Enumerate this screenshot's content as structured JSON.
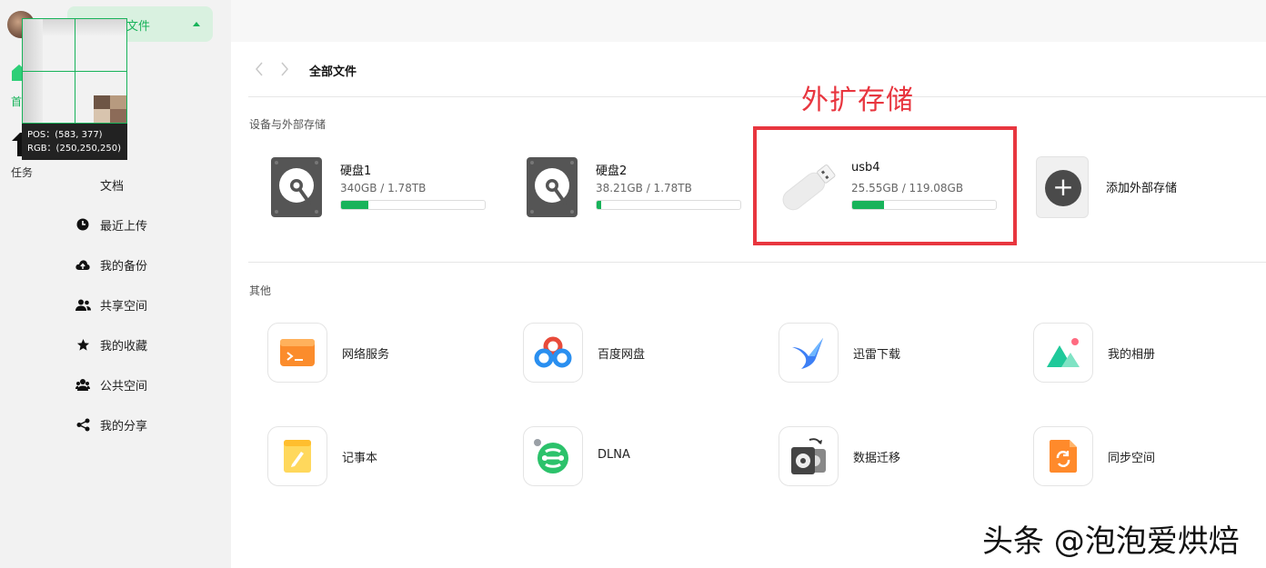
{
  "rail": {
    "home_label": "首",
    "task_label": "任务"
  },
  "sidebar": {
    "all_files_label": "文件",
    "items": [
      {
        "label": "文档",
        "icon": "document-icon"
      },
      {
        "label": "最近上传",
        "icon": "clock-icon"
      },
      {
        "label": "我的备份",
        "icon": "cloud-upload-icon"
      },
      {
        "label": "共享空间",
        "icon": "users-icon"
      },
      {
        "label": "我的收藏",
        "icon": "star-icon"
      },
      {
        "label": "公共空间",
        "icon": "group-icon"
      },
      {
        "label": "我的分享",
        "icon": "share-icon"
      }
    ]
  },
  "magnifier": {
    "pos": "POS：(583, 377)",
    "rgb": "RGB：(250,250,250)"
  },
  "main": {
    "breadcrumb": "全部文件",
    "devices_section": "设备与外部存储",
    "other_section": "其他",
    "drives": [
      {
        "name": "硬盘1",
        "size": "340GB / 1.78TB",
        "usage": 0.19
      },
      {
        "name": "硬盘2",
        "size": "38.21GB / 1.78TB",
        "usage": 0.03
      },
      {
        "name": "usb4",
        "size": "25.55GB / 119.08GB",
        "usage": 0.22
      }
    ],
    "add_storage_label": "添加外部存储",
    "apps": [
      {
        "label": "网络服务",
        "icon": "terminal-icon"
      },
      {
        "label": "百度网盘",
        "icon": "baidu-netdisk-icon"
      },
      {
        "label": "迅雷下载",
        "icon": "thunder-bird-icon"
      },
      {
        "label": "我的相册",
        "icon": "photo-album-icon"
      },
      {
        "label": "记事本",
        "icon": "notepad-icon"
      },
      {
        "label": "DLNA",
        "icon": "dlna-icon"
      },
      {
        "label": "数据迁移",
        "icon": "data-migration-icon"
      },
      {
        "label": "同步空间",
        "icon": "sync-space-icon"
      }
    ]
  },
  "annotation": {
    "label": "外扩存储",
    "color": "#e8363f"
  },
  "watermark": "头条 @泡泡爱烘焙",
  "colors": {
    "accent": "#18b35a"
  }
}
